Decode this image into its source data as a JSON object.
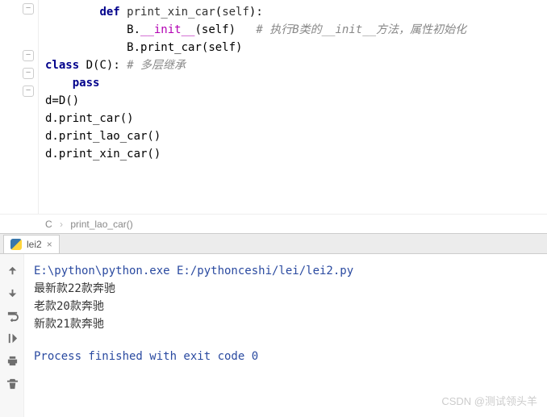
{
  "code": {
    "lines": [
      {
        "indent": 2,
        "kw": "def",
        "name": "print_xin_car",
        "params": "self",
        "after": ":",
        "type": "def"
      },
      {
        "indent": 3,
        "cls": "B.",
        "special": "__init__",
        "args": "self",
        "comment": "# 执行B类的__init__方法，属性初始化",
        "type": "call_special"
      },
      {
        "indent": 3,
        "cls": "B.",
        "method": "print_car",
        "args": "self",
        "type": "call"
      },
      {
        "indent": 0,
        "kw": "class",
        "name": "D",
        "base": "C",
        "after": ":",
        "comment": "# 多层继承",
        "type": "class"
      },
      {
        "indent": 1,
        "kw": "pass",
        "type": "pass"
      },
      {
        "indent": 0,
        "text": "d=D()",
        "type": "stmt"
      },
      {
        "indent": 0,
        "text": "d.print_car()",
        "type": "stmt"
      },
      {
        "indent": 0,
        "text": "d.print_lao_car()",
        "type": "stmt"
      },
      {
        "indent": 0,
        "text": "d.print_xin_car()",
        "type": "stmt"
      }
    ]
  },
  "breadcrumb": {
    "class": "C",
    "method": "print_lao_car()"
  },
  "tab": {
    "name": "lei2"
  },
  "console": {
    "command": "E:\\python\\python.exe E:/pythonceshi/lei/lei2.py",
    "output": [
      "最新款22款奔驰",
      "老款20款奔驰",
      "新款21款奔驰"
    ],
    "exit": "Process finished with exit code 0"
  },
  "watermark": "CSDN @测试领头羊"
}
